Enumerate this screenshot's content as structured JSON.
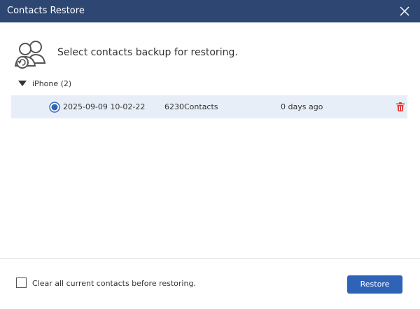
{
  "window": {
    "title": "Contacts Restore"
  },
  "header": {
    "text": "Select contacts backup for restoring."
  },
  "groups": [
    {
      "label": "iPhone (2)",
      "expanded": true,
      "rows": [
        {
          "date": "2025-09-09 10-02-22",
          "contacts": "6230Contacts",
          "age": "0 days ago",
          "selected": true
        }
      ]
    }
  ],
  "footer": {
    "checkbox_label": "Clear all current contacts before restoring.",
    "checkbox_checked": false,
    "restore_label": "Restore"
  },
  "colors": {
    "titlebar": "#2d4772",
    "accent": "#2f63b8",
    "row_selected": "#e8eef7",
    "delete": "#e53935"
  },
  "icons": {
    "close": "close-icon",
    "header": "contacts-restore-icon",
    "expand": "triangle-down-icon",
    "radio": "radio-selected-icon",
    "delete": "trash-icon"
  }
}
